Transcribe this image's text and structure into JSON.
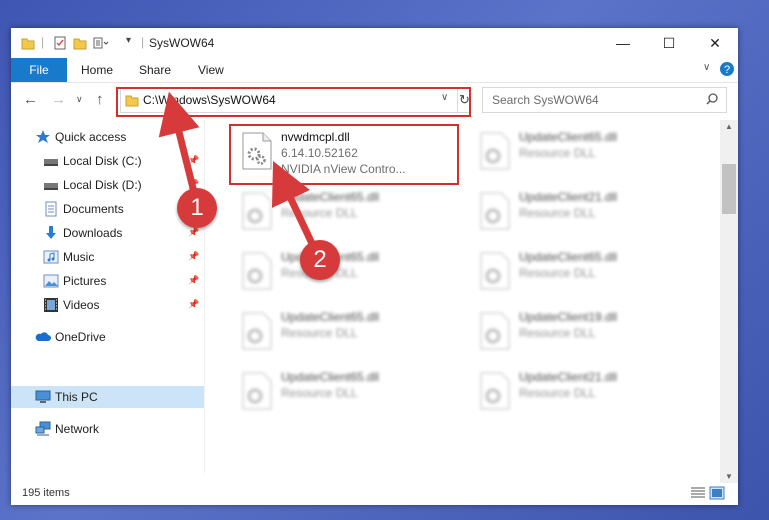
{
  "window": {
    "title": "SysWOW64"
  },
  "ribbon": {
    "file": "File",
    "home": "Home",
    "share": "Share",
    "view": "View"
  },
  "address": {
    "path": "C:\\Windows\\SysWOW64"
  },
  "search": {
    "placeholder": "Search SysWOW64"
  },
  "sidebar": {
    "items": [
      {
        "label": "Quick access",
        "icon": "star-icon"
      },
      {
        "label": "Local Disk (C:)",
        "icon": "drive-icon",
        "pinned": true
      },
      {
        "label": "Local Disk (D:)",
        "icon": "drive-icon",
        "pinned": true
      },
      {
        "label": "Documents",
        "icon": "documents-icon",
        "pinned": true
      },
      {
        "label": "Downloads",
        "icon": "download-icon",
        "pinned": true
      },
      {
        "label": "Music",
        "icon": "music-icon",
        "pinned": true
      },
      {
        "label": "Pictures",
        "icon": "pictures-icon",
        "pinned": true
      },
      {
        "label": "Videos",
        "icon": "videos-icon",
        "pinned": true
      },
      {
        "label": "OneDrive",
        "icon": "cloud-icon"
      },
      {
        "label": "This PC",
        "icon": "computer-icon",
        "selected": true
      },
      {
        "label": "Network",
        "icon": "network-icon"
      }
    ]
  },
  "files": {
    "highlighted": {
      "name": "nvwdmcpl.dll",
      "version": "6.14.10.52162",
      "description": "NVIDIA nView Contro..."
    },
    "left_column": [
      {
        "name": "UpdateClient65.dll",
        "type": "Resource DLL"
      },
      {
        "name": "UpdateClient65.dll",
        "type": "Resource DLL"
      },
      {
        "name": "UpdateClient65.dll",
        "type": "Resource DLL"
      },
      {
        "name": "UpdateClient65.dll",
        "type": "Resource DLL"
      }
    ],
    "right_column": [
      {
        "name": "UpdateClient65.dll",
        "type": "Resource DLL"
      },
      {
        "name": "UpdateClient21.dll",
        "type": "Resource DLL"
      },
      {
        "name": "UpdateClient65.dll",
        "type": "Resource DLL"
      },
      {
        "name": "UpdateClient19.dll",
        "type": "Resource DLL"
      },
      {
        "name": "UpdateClient21.dll",
        "type": "Resource DLL"
      }
    ]
  },
  "status": {
    "items": "195 items"
  },
  "annotations": {
    "callout_1": "1",
    "callout_2": "2"
  },
  "colors": {
    "accent": "#1979ca",
    "annotation": "#d32f2f",
    "selection": "#cce4f7"
  }
}
